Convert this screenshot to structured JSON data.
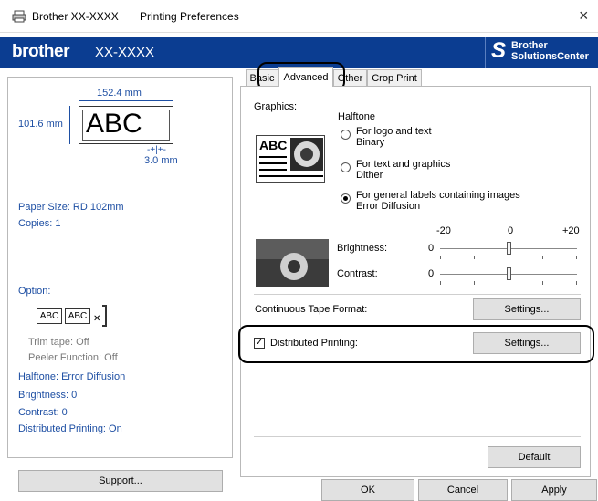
{
  "window": {
    "app_title": "Brother XX-XXXX",
    "dialog_title": "Printing Preferences",
    "close_glyph": "×"
  },
  "banner": {
    "brand": "brother",
    "model": "XX-XXXX",
    "solutions_line1": "Brother",
    "solutions_line2": "SolutionsCenter",
    "bg_color": "#0b3d91"
  },
  "preview": {
    "width_label": "152.4 mm",
    "height_label": "101.6 mm",
    "sample_text": "ABC",
    "margin_label": "3.0 mm"
  },
  "left": {
    "paper_size": "Paper Size: RD 102mm",
    "copies": "Copies: 1",
    "option_heading": "Option:",
    "option_sample1": "ABC",
    "option_sample2": "ABC",
    "trim_tape": "Trim tape: Off",
    "peeler": "Peeler Function: Off",
    "halftone": "Halftone: Error Diffusion",
    "brightness": "Brightness:  0",
    "contrast": "Contrast:  0",
    "distributed": "Distributed Printing: On",
    "support_button": "Support..."
  },
  "tabs": {
    "basic": "Basic",
    "advanced": "Advanced",
    "other": "Other",
    "crop": "Crop Print"
  },
  "advanced": {
    "graphics_label": "Graphics:",
    "halftone_label": "Halftone",
    "thumb_text": "ABC",
    "options": [
      {
        "line1": "For logo and text",
        "line2": "Binary",
        "selected": false
      },
      {
        "line1": "For text and graphics",
        "line2": "Dither",
        "selected": false
      },
      {
        "line1": "For general labels containing images",
        "line2": "Error Diffusion",
        "selected": true
      }
    ],
    "scale_min": "-20",
    "scale_mid": "0",
    "scale_max": "+20",
    "brightness_label": "Brightness:",
    "brightness_value": "0",
    "contrast_label": "Contrast:",
    "contrast_value": "0",
    "continuous_label": "Continuous Tape Format:",
    "continuous_settings": "Settings...",
    "distributed_label": "Distributed Printing:",
    "distributed_checked": true,
    "distributed_settings": "Settings...",
    "default_button": "Default"
  },
  "footer": {
    "ok": "OK",
    "cancel": "Cancel",
    "apply": "Apply"
  }
}
